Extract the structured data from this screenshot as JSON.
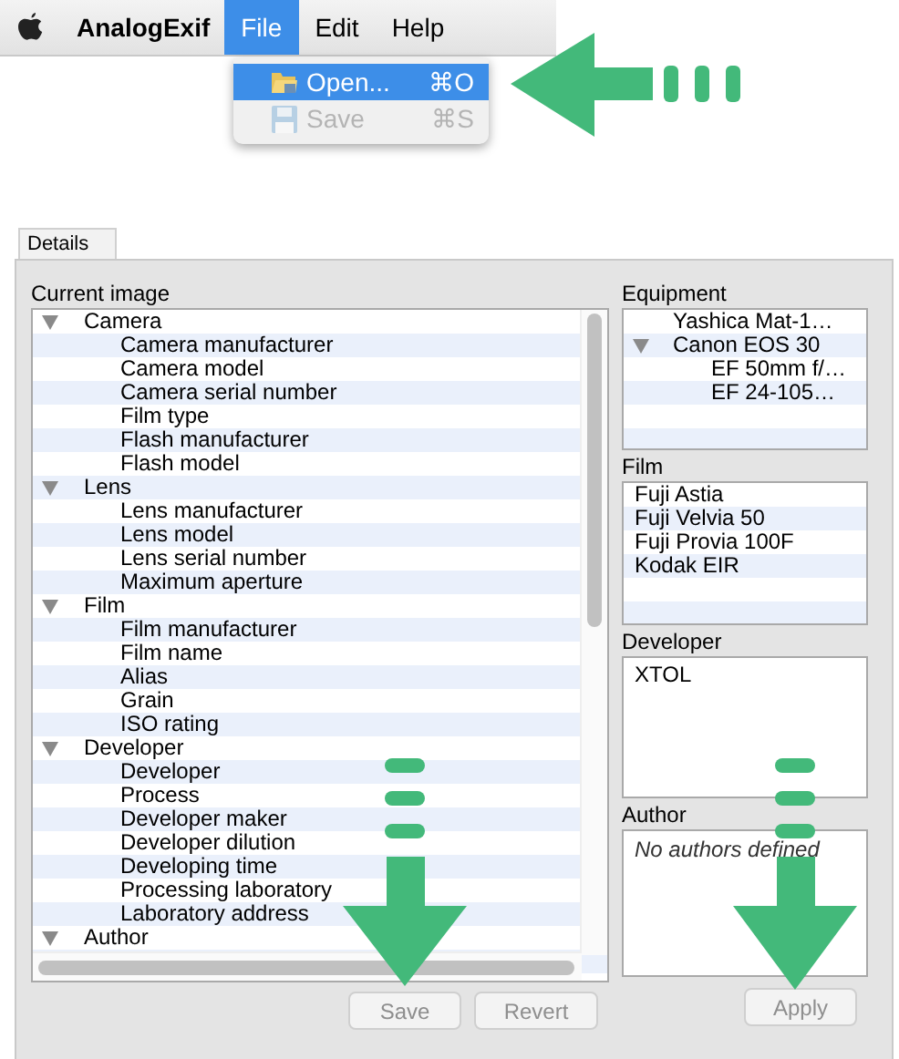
{
  "menubar": {
    "app_name": "AnalogExif",
    "menus": [
      {
        "label": "File",
        "selected": true
      },
      {
        "label": "Edit",
        "selected": false
      },
      {
        "label": "Help",
        "selected": false
      }
    ]
  },
  "file_menu": [
    {
      "label": "Open...",
      "shortcut": "⌘O",
      "selected": true,
      "disabled": false,
      "kind": "open"
    },
    {
      "label": "Save",
      "shortcut": "⌘S",
      "selected": false,
      "disabled": true,
      "kind": "save"
    }
  ],
  "details": {
    "tab": "Details",
    "current_image": {
      "label": "Current image",
      "tree": [
        {
          "label": "Camera",
          "expanded": true,
          "children": [
            {
              "label": "Camera manufacturer"
            },
            {
              "label": "Camera model"
            },
            {
              "label": "Camera serial number"
            },
            {
              "label": "Film type"
            },
            {
              "label": "Flash manufacturer"
            },
            {
              "label": "Flash model"
            }
          ]
        },
        {
          "label": "Lens",
          "expanded": true,
          "children": [
            {
              "label": "Lens manufacturer"
            },
            {
              "label": "Lens model"
            },
            {
              "label": "Lens serial number"
            },
            {
              "label": "Maximum aperture"
            }
          ]
        },
        {
          "label": "Film",
          "expanded": true,
          "children": [
            {
              "label": "Film manufacturer"
            },
            {
              "label": "Film name"
            },
            {
              "label": "Alias"
            },
            {
              "label": "Grain"
            },
            {
              "label": "ISO rating"
            }
          ]
        },
        {
          "label": "Developer",
          "expanded": true,
          "children": [
            {
              "label": "Developer"
            },
            {
              "label": "Process"
            },
            {
              "label": "Developer maker"
            },
            {
              "label": "Developer dilution"
            },
            {
              "label": "Developing time"
            },
            {
              "label": "Processing laboratory"
            },
            {
              "label": "Laboratory address"
            }
          ]
        },
        {
          "label": "Author",
          "expanded": true
        }
      ]
    },
    "buttons": [
      {
        "label": "Save",
        "disabled": true
      },
      {
        "label": "Revert",
        "disabled": true
      }
    ],
    "equipment": {
      "label": "Equipment",
      "tree": [
        {
          "label": "Yashica Mat-1…"
        },
        {
          "label": "Canon EOS 30",
          "expanded": true,
          "children": [
            {
              "label": "EF 50mm f/…"
            },
            {
              "label": "EF 24-105…"
            }
          ]
        }
      ]
    },
    "film": {
      "label": "Film",
      "items": [
        "Fuji Astia",
        "Fuji Velvia 50",
        "Fuji Provia 100F",
        "Kodak EIR"
      ]
    },
    "developer": {
      "label": "Developer",
      "items": [
        "XTOL"
      ]
    },
    "author": {
      "label": "Author",
      "placeholder": "No authors defined"
    },
    "apply": {
      "label": "Apply",
      "disabled": true
    }
  }
}
